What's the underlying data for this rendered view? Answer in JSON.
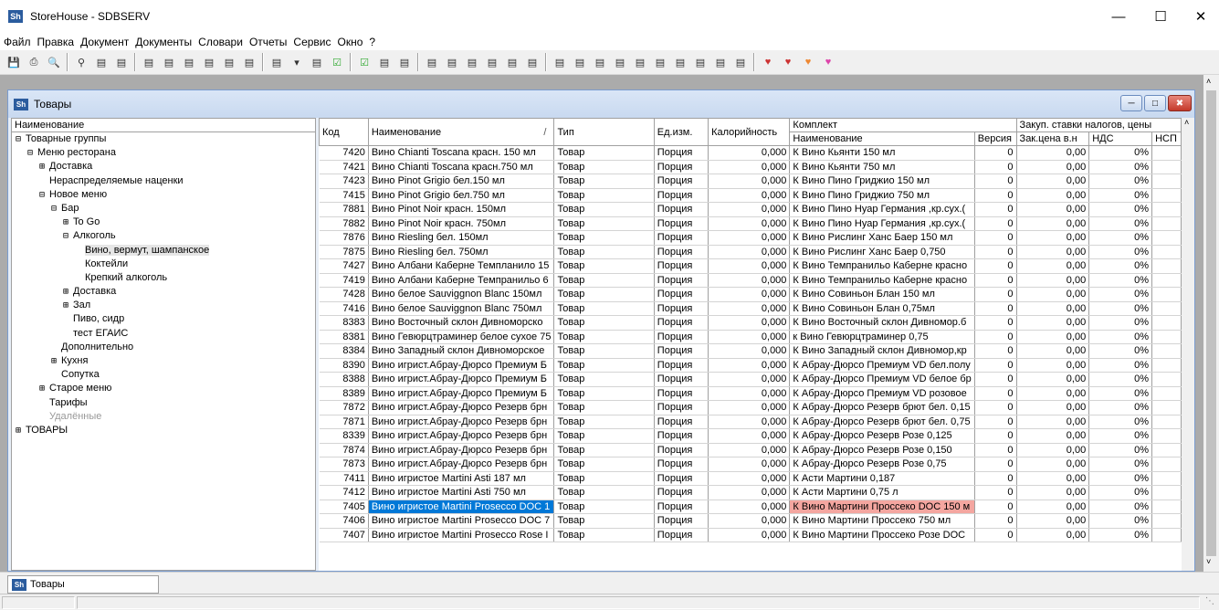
{
  "app": {
    "title": "StoreHouse - SDBSERV",
    "logo": "Sh"
  },
  "menu": [
    "Файл",
    "Правка",
    "Документ",
    "Документы",
    "Словари",
    "Отчеты",
    "Сервис",
    "Окно",
    "?"
  ],
  "toolbar_icons": [
    "save-icon",
    "print-icon",
    "print-preview-icon",
    "find-icon",
    "find-next-icon",
    "find-replace-icon",
    "new-doc-icon",
    "new-doc2-icon",
    "new-doc3-icon",
    "copy-icon",
    "export-icon",
    "doc-list-icon",
    "doc-list2-icon",
    "dropdown-icon",
    "doc3-icon",
    "check-icon",
    "check-all-icon",
    "report1-icon",
    "report2-icon",
    "users-icon",
    "users2-icon",
    "users3-icon",
    "rpt-a-icon",
    "rpt-b-icon",
    "rpt-c-icon",
    "rpt-d-icon",
    "rpt-e-icon",
    "rpt-f-icon",
    "rpt-g-icon",
    "rpt-h-icon",
    "rpt-i-icon",
    "rpt-j-icon",
    "rpt-k-icon",
    "rpt-l-icon",
    "rpt-m-icon",
    "heart-a-icon",
    "heart-b-icon",
    "heart-c-icon",
    "heart-d-icon"
  ],
  "child": {
    "title": "Товары",
    "logo": "Sh"
  },
  "tree": {
    "header": "Наименование",
    "rows": [
      {
        "indent": 0,
        "exp": "⊟",
        "label": "Товарные группы"
      },
      {
        "indent": 1,
        "exp": "⊟",
        "label": "Меню ресторана"
      },
      {
        "indent": 2,
        "exp": "⊞",
        "label": "Доставка"
      },
      {
        "indent": 2,
        "exp": "",
        "label": "Нераспределяемые наценки"
      },
      {
        "indent": 2,
        "exp": "⊟",
        "label": "Новое меню"
      },
      {
        "indent": 3,
        "exp": "⊟",
        "label": "Бар"
      },
      {
        "indent": 4,
        "exp": "⊞",
        "label": "To Go"
      },
      {
        "indent": 4,
        "exp": "⊟",
        "label": "Алкоголь"
      },
      {
        "indent": 5,
        "exp": "",
        "label": "Вино, вермут, шампанское",
        "selected": true
      },
      {
        "indent": 5,
        "exp": "",
        "label": "Коктейли"
      },
      {
        "indent": 5,
        "exp": "",
        "label": "Крепкий алкоголь"
      },
      {
        "indent": 4,
        "exp": "⊞",
        "label": "Доставка"
      },
      {
        "indent": 4,
        "exp": "⊞",
        "label": "Зал"
      },
      {
        "indent": 4,
        "exp": "",
        "label": "Пиво, сидр"
      },
      {
        "indent": 4,
        "exp": "",
        "label": "тест ЕГАИС"
      },
      {
        "indent": 3,
        "exp": "",
        "label": "Дополнительно"
      },
      {
        "indent": 3,
        "exp": "⊞",
        "label": "Кухня"
      },
      {
        "indent": 3,
        "exp": "",
        "label": "Сопутка"
      },
      {
        "indent": 2,
        "exp": "⊞",
        "label": "Старое меню"
      },
      {
        "indent": 2,
        "exp": "",
        "label": "Тарифы"
      },
      {
        "indent": 2,
        "exp": "",
        "label": "Удалённые",
        "dim": true
      },
      {
        "indent": 0,
        "exp": "⊞",
        "label": "ТОВАРЫ"
      }
    ]
  },
  "grid": {
    "headers": {
      "code": "Код",
      "name": "Наименование",
      "sort_marker": "/",
      "type": "Тип",
      "unit": "Ед.изм.",
      "cal": "Калорийность",
      "kit": "Комплект",
      "kit_name": "Наименование",
      "kit_version": "Версия",
      "tax": "Закуп. ставки налогов, цены",
      "price": "Зак.цена в.н",
      "vat": "НДС",
      "nsp": "НСП"
    },
    "rows": [
      {
        "code": "7420",
        "name": "Вино Chianti Toscana красн. 150 мл",
        "type": "Товар",
        "unit": "Порция",
        "cal": "0,000",
        "kit": "К Вино Кьянти 150 мл",
        "ver": "0",
        "price": "0,00",
        "vat": "0%"
      },
      {
        "code": "7421",
        "name": "Вино Chianti Toscana красн.750 мл",
        "type": "Товар",
        "unit": "Порция",
        "cal": "0,000",
        "kit": "К Вино Кьянти 750 мл",
        "ver": "0",
        "price": "0,00",
        "vat": "0%"
      },
      {
        "code": "7423",
        "name": "Вино Pinot Grigio бел.150 мл",
        "type": "Товар",
        "unit": "Порция",
        "cal": "0,000",
        "kit": "К Вино Пино Гриджио 150 мл",
        "ver": "0",
        "price": "0,00",
        "vat": "0%"
      },
      {
        "code": "7415",
        "name": "Вино Pinot Grigio бел.750 мл",
        "type": "Товар",
        "unit": "Порция",
        "cal": "0,000",
        "kit": "К Вино Пино Гриджио 750 мл",
        "ver": "0",
        "price": "0,00",
        "vat": "0%"
      },
      {
        "code": "7881",
        "name": "Вино Pinot Noir красн. 150мл",
        "type": "Товар",
        "unit": "Порция",
        "cal": "0,000",
        "kit": "К Вино Пино Нуар Германия ,кр.сух.(",
        "ver": "0",
        "price": "0,00",
        "vat": "0%"
      },
      {
        "code": "7882",
        "name": "Вино Pinot Noir красн. 750мл",
        "type": "Товар",
        "unit": "Порция",
        "cal": "0,000",
        "kit": "К Вино Пино Нуар Германия ,кр.сух.(",
        "ver": "0",
        "price": "0,00",
        "vat": "0%"
      },
      {
        "code": "7876",
        "name": "Вино Riesling бел. 150мл",
        "type": "Товар",
        "unit": "Порция",
        "cal": "0,000",
        "kit": "К Вино Рислинг Ханс Баер 150 мл",
        "ver": "0",
        "price": "0,00",
        "vat": "0%"
      },
      {
        "code": "7875",
        "name": "Вино Riesling бел. 750мл",
        "type": "Товар",
        "unit": "Порция",
        "cal": "0,000",
        "kit": "К Вино Рислинг Ханс Баер 0,750",
        "ver": "0",
        "price": "0,00",
        "vat": "0%"
      },
      {
        "code": "7427",
        "name": "Вино Албани Каберне Темпланило 15",
        "type": "Товар",
        "unit": "Порция",
        "cal": "0,000",
        "kit": "К Вино Темпранильо Каберне красно",
        "ver": "0",
        "price": "0,00",
        "vat": "0%"
      },
      {
        "code": "7419",
        "name": "Вино Албани Каберне Темпранильо 6",
        "type": "Товар",
        "unit": "Порция",
        "cal": "0,000",
        "kit": "К Вино Темпранильо Каберне красно",
        "ver": "0",
        "price": "0,00",
        "vat": "0%"
      },
      {
        "code": "7428",
        "name": "Вино белое Sauviggnon Blanc 150мл",
        "type": "Товар",
        "unit": "Порция",
        "cal": "0,000",
        "kit": "К Вино Совиньон Блан 150 мл",
        "ver": "0",
        "price": "0,00",
        "vat": "0%"
      },
      {
        "code": "7416",
        "name": "Вино белое Sauviggnon Blanc 750мл",
        "type": "Товар",
        "unit": "Порция",
        "cal": "0,000",
        "kit": "К Вино Совиньон Блан 0,75мл",
        "ver": "0",
        "price": "0,00",
        "vat": "0%"
      },
      {
        "code": "8383",
        "name": "Вино Восточный склон Дивноморско",
        "type": "Товар",
        "unit": "Порция",
        "cal": "0,000",
        "kit": "К Вино Восточный склон Дивномор.б",
        "ver": "0",
        "price": "0,00",
        "vat": "0%"
      },
      {
        "code": "8381",
        "name": "Вино Гевюрцтраминер белое сухое 75",
        "type": "Товар",
        "unit": "Порция",
        "cal": "0,000",
        "kit": "к Вино Гевюрцтраминер 0,75",
        "ver": "0",
        "price": "0,00",
        "vat": "0%"
      },
      {
        "code": "8384",
        "name": "Вино Западный склон Дивноморское",
        "type": "Товар",
        "unit": "Порция",
        "cal": "0,000",
        "kit": "К Вино Западный склон Дивномор,кр",
        "ver": "0",
        "price": "0,00",
        "vat": "0%"
      },
      {
        "code": "8390",
        "name": "Вино игрист.Абрау-Дюрсо Премиум Б",
        "type": "Товар",
        "unit": "Порция",
        "cal": "0,000",
        "kit": "К Абрау-Дюрсо Премиум VD бел.полу",
        "ver": "0",
        "price": "0,00",
        "vat": "0%"
      },
      {
        "code": "8388",
        "name": "Вино игрист.Абрау-Дюрсо Премиум Б",
        "type": "Товар",
        "unit": "Порция",
        "cal": "0,000",
        "kit": "К Абрау-Дюрсо Премиум VD белое бр",
        "ver": "0",
        "price": "0,00",
        "vat": "0%"
      },
      {
        "code": "8389",
        "name": "Вино игрист.Абрау-Дюрсо Премиум Б",
        "type": "Товар",
        "unit": "Порция",
        "cal": "0,000",
        "kit": "К Абрау-Дюрсо Премиум VD розовое",
        "ver": "0",
        "price": "0,00",
        "vat": "0%"
      },
      {
        "code": "7872",
        "name": "Вино игрист.Абрау-Дюрсо Резерв брн",
        "type": "Товар",
        "unit": "Порция",
        "cal": "0,000",
        "kit": "К Абрау-Дюрсо Резерв брют бел. 0,15",
        "ver": "0",
        "price": "0,00",
        "vat": "0%"
      },
      {
        "code": "7871",
        "name": "Вино игрист.Абрау-Дюрсо Резерв брн",
        "type": "Товар",
        "unit": "Порция",
        "cal": "0,000",
        "kit": "К Абрау-Дюрсо Резерв брют бел. 0,75",
        "ver": "0",
        "price": "0,00",
        "vat": "0%"
      },
      {
        "code": "8339",
        "name": "Вино игрист.Абрау-Дюрсо Резерв брн",
        "type": "Товар",
        "unit": "Порция",
        "cal": "0,000",
        "kit": "К Абрау-Дюрсо Резерв Розе 0,125",
        "ver": "0",
        "price": "0,00",
        "vat": "0%"
      },
      {
        "code": "7874",
        "name": "Вино игрист.Абрау-Дюрсо Резерв брн",
        "type": "Товар",
        "unit": "Порция",
        "cal": "0,000",
        "kit": "К Абрау-Дюрсо Резерв Розе 0,150",
        "ver": "0",
        "price": "0,00",
        "vat": "0%"
      },
      {
        "code": "7873",
        "name": "Вино игрист.Абрау-Дюрсо Резерв брн",
        "type": "Товар",
        "unit": "Порция",
        "cal": "0,000",
        "kit": "К Абрау-Дюрсо Резерв Розе 0,75",
        "ver": "0",
        "price": "0,00",
        "vat": "0%"
      },
      {
        "code": "7411",
        "name": "Вино игристое Martini Asti 187 мл",
        "type": "Товар",
        "unit": "Порция",
        "cal": "0,000",
        "kit": "К Асти Мартини 0,187",
        "ver": "0",
        "price": "0,00",
        "vat": "0%"
      },
      {
        "code": "7412",
        "name": "Вино игристое Martini Asti 750 мл",
        "type": "Товар",
        "unit": "Порция",
        "cal": "0,000",
        "kit": "К Асти Мартини 0,75 л",
        "ver": "0",
        "price": "0,00",
        "vat": "0%"
      },
      {
        "code": "7405",
        "name": "Вино игристое Martini Prosecco DOC 1",
        "type": "Товар",
        "unit": "Порция",
        "cal": "0,000",
        "kit": "К Вино Мартини Проссеко DOC 150 м",
        "ver": "0",
        "price": "0,00",
        "vat": "0%",
        "selected": true
      },
      {
        "code": "7406",
        "name": "Вино игристое Martini Prosecco DOC 7",
        "type": "Товар",
        "unit": "Порция",
        "cal": "0,000",
        "kit": "К Вино Мартини Проссеко 750 мл",
        "ver": "0",
        "price": "0,00",
        "vat": "0%"
      },
      {
        "code": "7407",
        "name": "Вино игристое Martini Prosecco Rose I",
        "type": "Товар",
        "unit": "Порция",
        "cal": "0,000",
        "kit": "К Вино Мартини Проссеко Розе DOC",
        "ver": "0",
        "price": "0,00",
        "vat": "0%"
      }
    ]
  },
  "taskbar": {
    "tab_label": "Товары"
  },
  "colors": {
    "selection": "#0078d7",
    "highlight": "#f4a6a0",
    "mdi_bg": "#ababab"
  }
}
